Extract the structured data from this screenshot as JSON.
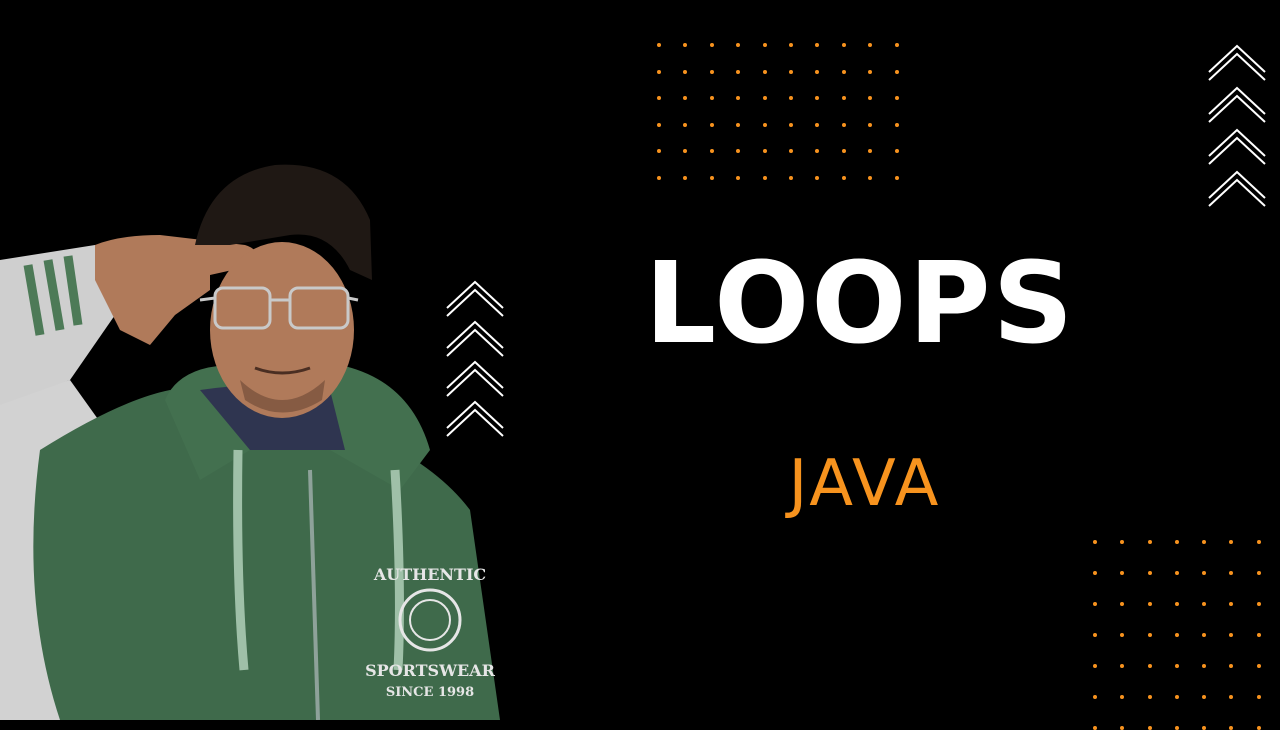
{
  "thumbnail": {
    "title": "LOOPS",
    "subtitle": "JAVA",
    "jacket_text_top": "AUTHENTIC",
    "jacket_text_bottom": "SPORTSWEAR",
    "jacket_text_since": "SINCE 1998"
  },
  "colors": {
    "background": "#000000",
    "accent": "#F7931E",
    "title": "#FFFFFF",
    "chevron": "#FFFFFF",
    "jacket": "#3F6A4B",
    "sleeve": "#CFCFCF"
  },
  "decorations": {
    "dot_grid_top": {
      "rows": 6,
      "cols": 10
    },
    "dot_grid_bottom": {
      "rows": 7,
      "cols": 7
    },
    "chevron_stacks": [
      {
        "count": 4
      },
      {
        "count": 4
      }
    ]
  },
  "icons": [
    "chevron-up-icon",
    "dot-grid-pattern",
    "person-photo"
  ]
}
